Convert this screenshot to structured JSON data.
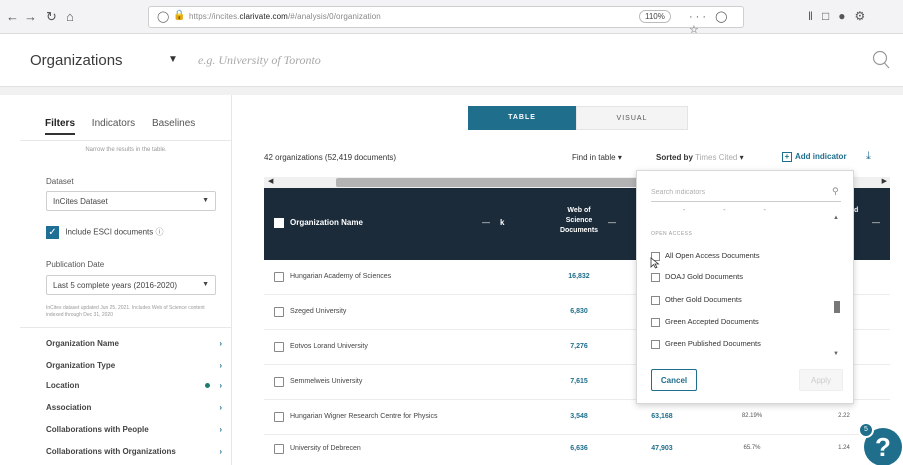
{
  "browser": {
    "url_prefix": "https://incites.",
    "url_domain": "clarivate.com",
    "url_path": "/#/analysis/0/organization",
    "zoom": "110%",
    "more_label": "···"
  },
  "app": {
    "title": "Organizations",
    "search_placeholder": "e.g. University of Toronto"
  },
  "sidebar": {
    "tabs": [
      "Filters",
      "Indicators",
      "Baselines"
    ],
    "narrow_hint": "Narrow the results in the table.",
    "dataset_label": "Dataset",
    "dataset_value": "InCites Dataset",
    "esci_label": "Include ESCI documents",
    "pub_date_label": "Publication Date",
    "pub_date_value": "Last 5 complete years (2016-2020)",
    "note": "InCites dataset updated Jun 25, 2021. Includes Web of Science content indexed through Dec 31, 2020",
    "facets": [
      "Organization Name",
      "Organization Type",
      "Location",
      "Association",
      "Collaborations with People",
      "Collaborations with Organizations"
    ]
  },
  "main": {
    "view_table": "TABLE",
    "view_visual": "VISUAL",
    "count": "42 organizations (52,419 documents)",
    "find_in_table": "Find in table",
    "sorted_by": "Sorted by",
    "sorted_value": "Times Cited",
    "add_indicator": "Add indicator",
    "columns": {
      "org_name": "Organization Name",
      "k": "k",
      "wos_line1": "Web of",
      "wos_line2": "Science",
      "wos_line3": "Documents",
      "last_col": "d"
    },
    "rows": [
      {
        "name": "Hungarian Academy of Sciences",
        "wos": "16,832",
        "cited": "",
        "pct": "",
        "num": ""
      },
      {
        "name": "Szeged University",
        "wos": "6,830",
        "cited": "",
        "pct": "",
        "num": ""
      },
      {
        "name": "Eotvos Lorand University",
        "wos": "7,276",
        "cited": "",
        "pct": "",
        "num": ""
      },
      {
        "name": "Semmelweis University",
        "wos": "7,615",
        "cited": "",
        "pct": "",
        "num": ""
      },
      {
        "name": "Hungarian Wigner Research Centre for Physics",
        "wos": "3,548",
        "cited": "63,168",
        "pct": "82.19%",
        "num": "2.22"
      },
      {
        "name": "University of Debrecen",
        "wos": "6,636",
        "cited": "47,903",
        "pct": "65.7%",
        "num": "1.24"
      }
    ]
  },
  "indicator_dropdown": {
    "search_placeholder": "Search indicators",
    "section": "OPEN ACCESS",
    "options": [
      "All Open Access Documents",
      "DOAJ Gold Documents",
      "Other Gold Documents",
      "Green Accepted Documents",
      "Green Published Documents"
    ],
    "cancel": "Cancel",
    "apply": "Apply"
  },
  "help": {
    "icon": "?",
    "badge": "5"
  },
  "colors": {
    "accent": "#1e6e8c",
    "header_dark": "#1b2b3a"
  }
}
